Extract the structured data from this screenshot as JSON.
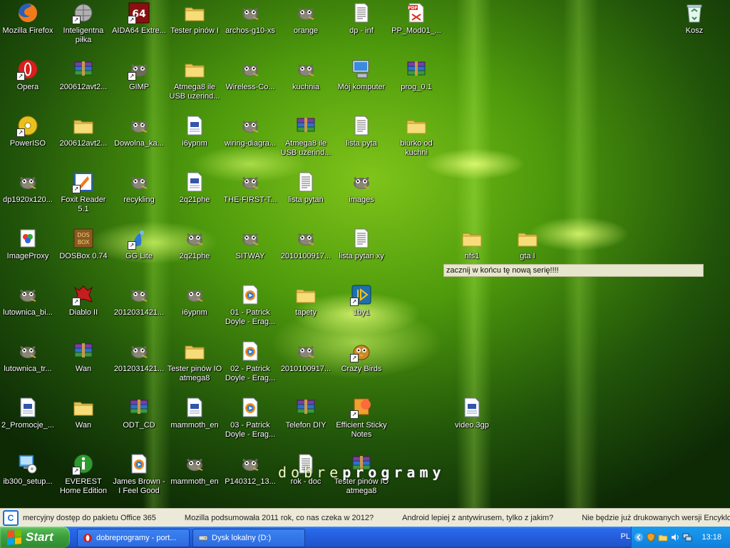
{
  "desktop": {
    "icons": [
      {
        "label": "Mozilla Firefox",
        "icon": "firefox-icon",
        "shortcut": false
      },
      {
        "label": "Opera",
        "icon": "opera-icon",
        "shortcut": true
      },
      {
        "label": "PowerISO",
        "icon": "poweriso-icon",
        "shortcut": true
      },
      {
        "label": "dp1920x120...",
        "icon": "gimp-image-icon",
        "shortcut": false
      },
      {
        "label": "ImageProxy",
        "icon": "imageproxy-icon",
        "shortcut": false
      },
      {
        "label": "lutownica_bi...",
        "icon": "gimp-image-icon",
        "shortcut": false
      },
      {
        "label": "lutownica_tr...",
        "icon": "gimp-image-icon",
        "shortcut": false
      },
      {
        "label": "2_Promocje_...",
        "icon": "document-icon",
        "shortcut": false
      },
      {
        "label": "ib300_setup...",
        "icon": "setup-icon",
        "shortcut": false
      },
      {
        "label": "Inteligentna piłka",
        "icon": "ball-icon",
        "shortcut": true
      },
      {
        "label": "200612avt2...",
        "icon": "winrar-archive-icon",
        "shortcut": false
      },
      {
        "label": "200612avt2...",
        "icon": "folder-icon",
        "shortcut": false
      },
      {
        "label": "Foxit Reader 5.1",
        "icon": "foxit-icon",
        "shortcut": true
      },
      {
        "label": "DOSBox 0.74",
        "icon": "dosbox-icon",
        "shortcut": false
      },
      {
        "label": "Diablo II",
        "icon": "diablo-icon",
        "shortcut": true
      },
      {
        "label": "Wan",
        "icon": "winrar-archive-icon",
        "shortcut": false
      },
      {
        "label": "Wan",
        "icon": "folder-icon",
        "shortcut": false
      },
      {
        "label": "EVEREST Home Edition",
        "icon": "everest-icon",
        "shortcut": true
      },
      {
        "label": "AIDA64 Extre...",
        "icon": "aida64-icon",
        "shortcut": true
      },
      {
        "label": "GIMP",
        "icon": "gimp-icon",
        "shortcut": true
      },
      {
        "label": "Dowolna_ka...",
        "icon": "gimp-image-icon",
        "shortcut": false
      },
      {
        "label": "recykling",
        "icon": "gimp-image-icon",
        "shortcut": false
      },
      {
        "label": "GG Lite",
        "icon": "gg-icon",
        "shortcut": true
      },
      {
        "label": "2012031421...",
        "icon": "gimp-image-icon",
        "shortcut": false
      },
      {
        "label": "2012031421...",
        "icon": "gimp-image-icon",
        "shortcut": false
      },
      {
        "label": "ODT_CD",
        "icon": "winrar-archive-icon",
        "shortcut": false
      },
      {
        "label": "James Brown - I Feel Good",
        "icon": "media-icon",
        "shortcut": false
      },
      {
        "label": "Tester pinów I",
        "icon": "folder-icon",
        "shortcut": false
      },
      {
        "label": "Atmega8 ile USB uzerind...",
        "icon": "folder-icon",
        "shortcut": false
      },
      {
        "label": "i6ypnm",
        "icon": "document-icon",
        "shortcut": false
      },
      {
        "label": "2q21phe",
        "icon": "document-icon",
        "shortcut": false
      },
      {
        "label": "2q21phe",
        "icon": "gimp-image-icon",
        "shortcut": false
      },
      {
        "label": "i6ypnm",
        "icon": "gimp-image-icon",
        "shortcut": false
      },
      {
        "label": "Tester pinów IO atmega8",
        "icon": "folder-icon",
        "shortcut": false
      },
      {
        "label": "mammoth_en",
        "icon": "document-icon",
        "shortcut": false
      },
      {
        "label": "mammoth_en",
        "icon": "gimp-image-icon",
        "shortcut": false
      },
      {
        "label": "archos-g10-xs",
        "icon": "gimp-image-icon",
        "shortcut": false
      },
      {
        "label": "Wireless-Co...",
        "icon": "gimp-image-icon",
        "shortcut": false
      },
      {
        "label": "wiring-diagra...",
        "icon": "gimp-image-icon",
        "shortcut": false
      },
      {
        "label": "THE-FIRST-T...",
        "icon": "gimp-image-icon",
        "shortcut": false
      },
      {
        "label": "SITWAY",
        "icon": "gimp-image-icon",
        "shortcut": false
      },
      {
        "label": "01 - Patrick Doyle - Erag...",
        "icon": "media-icon",
        "shortcut": false
      },
      {
        "label": "02 - Patrick Doyle - Erag...",
        "icon": "media-icon",
        "shortcut": false
      },
      {
        "label": "03 - Patrick Doyle - Erag...",
        "icon": "media-icon",
        "shortcut": false
      },
      {
        "label": "P140312_13...",
        "icon": "gimp-image-icon",
        "shortcut": false
      },
      {
        "label": "orange",
        "icon": "gimp-image-icon",
        "shortcut": false
      },
      {
        "label": "kuchnia",
        "icon": "gimp-image-icon",
        "shortcut": false
      },
      {
        "label": "Atmega8 ile USB uzerind...",
        "icon": "winrar-archive-icon",
        "shortcut": false
      },
      {
        "label": "lista pytań",
        "icon": "text-document-icon",
        "shortcut": false
      },
      {
        "label": "2010100917...",
        "icon": "gimp-image-icon",
        "shortcut": false
      },
      {
        "label": "tapety",
        "icon": "folder-icon",
        "shortcut": false
      },
      {
        "label": "2010100917...",
        "icon": "gimp-image-icon",
        "shortcut": false
      },
      {
        "label": "Telefon DIY",
        "icon": "winrar-archive-icon",
        "shortcut": false
      },
      {
        "label": "rok - doc",
        "icon": "text-document-icon",
        "shortcut": false
      },
      {
        "label": "dp - inf",
        "icon": "text-document-icon",
        "shortcut": false
      },
      {
        "label": "Mój komputer",
        "icon": "my-computer-icon",
        "shortcut": false
      },
      {
        "label": "lista pyta",
        "icon": "text-document-icon",
        "shortcut": false
      },
      {
        "label": "images",
        "icon": "gimp-image-icon",
        "shortcut": false
      },
      {
        "label": "lista pytan xy",
        "icon": "text-document-icon",
        "shortcut": false
      },
      {
        "label": "1by1",
        "icon": "1by1-icon",
        "shortcut": true
      },
      {
        "label": "Crazy Birds",
        "icon": "crazy-birds-icon",
        "shortcut": true
      },
      {
        "label": "Efficient Sticky Notes",
        "icon": "sticky-notes-icon",
        "shortcut": true
      },
      {
        "label": "Tester pinów IO atmega8",
        "icon": "winrar-archive-icon",
        "shortcut": false
      },
      {
        "label": "PP_Mod01_...",
        "icon": "pdf-icon",
        "shortcut": false
      },
      {
        "label": "prog_0.1",
        "icon": "winrar-archive-icon",
        "shortcut": false
      },
      {
        "label": "biurko od kuchni",
        "icon": "folder-icon",
        "shortcut": false
      },
      {
        "label": "nfs1",
        "icon": "folder-icon",
        "shortcut": false
      },
      {
        "label": "video.3gp",
        "icon": "document-icon",
        "shortcut": false
      },
      {
        "label": "gta I",
        "icon": "folder-icon",
        "shortcut": false
      },
      {
        "label": "Kosz",
        "icon": "recycle-bin-icon",
        "shortcut": false
      }
    ],
    "note_text": "zacznij w końcu tę nową serię!!!!",
    "logo_light": "dobre",
    "logo_bold": "programy"
  },
  "ticker": {
    "logo_letter": "C",
    "items": [
      "mercyjny dostęp do pakietu Office 365",
      "Mozilla podsumowała 2011 rok, co nas czeka w 2012?",
      "Android lepiej z antywirusem, tylko z jakim?",
      "Nie będzie już drukowanych wersji Encyklopedii"
    ]
  },
  "taskbar": {
    "start_label": "Start",
    "tasks": [
      {
        "label": "dobreprogramy - port...",
        "icon": "opera-icon"
      },
      {
        "label": "Dysk lokalny (D:)",
        "icon": "drive-icon"
      }
    ],
    "language": "PL",
    "clock": "13:18"
  },
  "colors": {
    "taskbar_blue": "#245edc",
    "start_green": "#3c9f3c",
    "tray_blue": "#0f7fdc",
    "note_background": "#e6e6cc"
  }
}
